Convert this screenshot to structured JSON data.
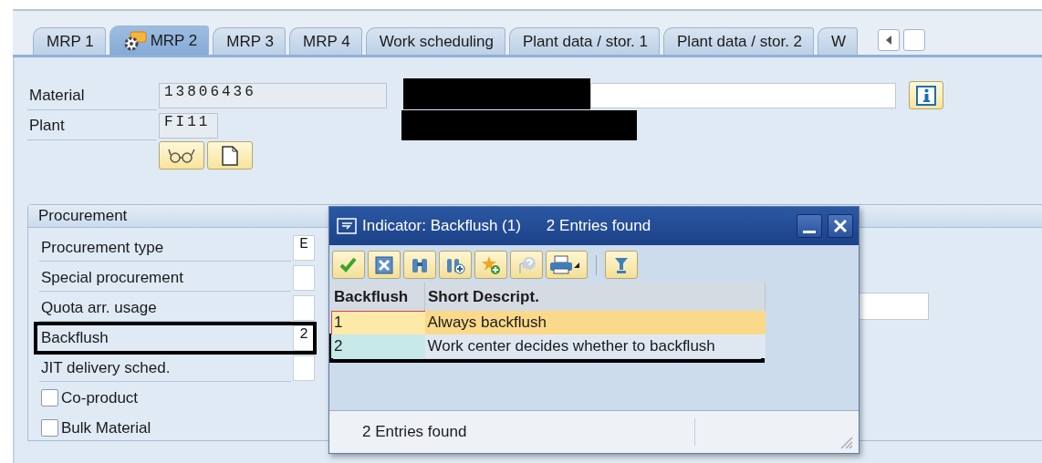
{
  "tabs": [
    {
      "label": "MRP 1",
      "selected": false
    },
    {
      "label": "MRP 2",
      "selected": true
    },
    {
      "label": "MRP 3",
      "selected": false
    },
    {
      "label": "MRP 4",
      "selected": false
    },
    {
      "label": "Work scheduling",
      "selected": false
    },
    {
      "label": "Plant data / stor. 1",
      "selected": false
    },
    {
      "label": "Plant data / stor. 2",
      "selected": false
    },
    {
      "label": "W",
      "selected": false
    }
  ],
  "header": {
    "fields": [
      {
        "label": "Material",
        "value": "13806436"
      },
      {
        "label": "Plant",
        "value": "FI11"
      }
    ]
  },
  "procurement": {
    "title": "Procurement",
    "rows": [
      {
        "kind": "field",
        "label": "Procurement type",
        "value": "E",
        "highlighted": false
      },
      {
        "kind": "field",
        "label": "Special procurement",
        "highlighted": false
      },
      {
        "kind": "field",
        "label": "Quota arr. usage",
        "highlighted": false
      },
      {
        "kind": "field",
        "label": "Backflush",
        "value": "2",
        "highlighted": true
      },
      {
        "kind": "field",
        "label": "JIT delivery sched.",
        "highlighted": false
      },
      {
        "kind": "checkbox",
        "label": "Co-product",
        "checked": false
      },
      {
        "kind": "checkbox",
        "label": "Bulk Material",
        "checked": false
      }
    ]
  },
  "popup": {
    "title": "Indicator: Backflush (1)",
    "subtitle": "2 Entries found",
    "columns": [
      "Backflush",
      "Short Descript."
    ],
    "rows": [
      {
        "cells": [
          "1",
          "Always backflush"
        ],
        "selected": true,
        "highlighted": false
      },
      {
        "cells": [
          "2",
          "Work center decides whether to backflush"
        ],
        "selected": false,
        "highlighted": true
      }
    ],
    "status": "2 Entries found"
  }
}
